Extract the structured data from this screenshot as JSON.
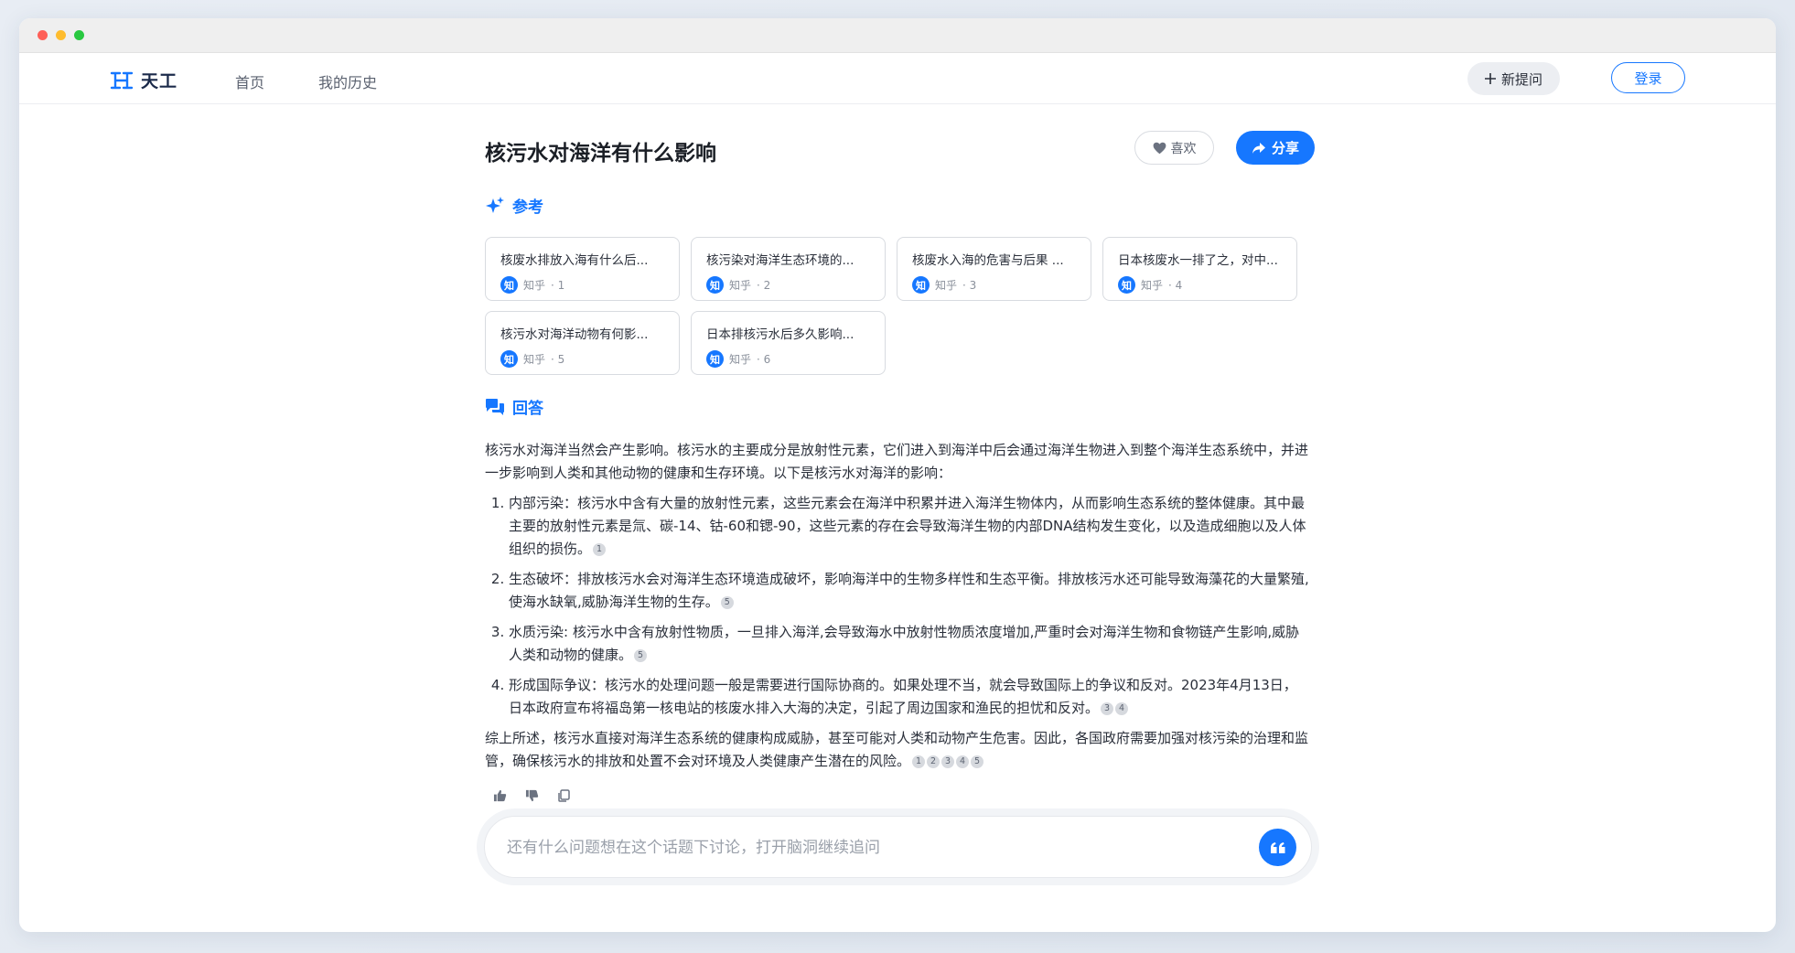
{
  "app": {
    "name": "天工"
  },
  "nav": {
    "home": "首页",
    "history": "我的历史",
    "new_question": "新提问",
    "login": "登录"
  },
  "question": {
    "title": "核污水对海洋有什么影响",
    "like_label": "喜欢",
    "share_label": "分享"
  },
  "references": {
    "heading": "参考",
    "items": [
      {
        "title": "核废水排放入海有什么后...",
        "source": "知乎",
        "badge": "知",
        "index": "· 1"
      },
      {
        "title": "核污染对海洋生态环境的...",
        "source": "知乎",
        "badge": "知",
        "index": "· 2"
      },
      {
        "title": "核废水入海的危害与后果 ...",
        "source": "知乎",
        "badge": "知",
        "index": "· 3"
      },
      {
        "title": "日本核废水一排了之，对中...",
        "source": "知乎",
        "badge": "知",
        "index": "· 4"
      },
      {
        "title": "核污水对海洋动物有何影...",
        "source": "知乎",
        "badge": "知",
        "index": "· 5"
      },
      {
        "title": "日本排核污水后多久影响...",
        "source": "知乎",
        "badge": "知",
        "index": "· 6"
      }
    ]
  },
  "answer": {
    "heading": "回答",
    "intro": "核污水对海洋当然会产生影响。核污水的主要成分是放射性元素，它们进入到海洋中后会通过海洋生物进入到整个海洋生态系统中，并进一步影响到人类和其他动物的健康和生存环境。以下是核污水对海洋的影响：",
    "points": [
      {
        "text": "内部污染：核污水中含有大量的放射性元素，这些元素会在海洋中积累并进入海洋生物体内，从而影响生态系统的整体健康。其中最主要的放射性元素是氚、碳-14、钴-60和锶-90，这些元素的存在会导致海洋生物的内部DNA结构发生变化，以及造成细胞以及人体组织的损伤。",
        "cites": [
          "1"
        ]
      },
      {
        "text": "生态破坏：排放核污水会对海洋生态环境造成破坏，影响海洋中的生物多样性和生态平衡。排放核污水还可能导致海藻花的大量繁殖,使海水缺氧,威胁海洋生物的生存。",
        "cites": [
          "5"
        ]
      },
      {
        "text": "水质污染: 核污水中含有放射性物质，一旦排入海洋,会导致海水中放射性物质浓度增加,严重时会对海洋生物和食物链产生影响,威胁人类和动物的健康。",
        "cites": [
          "5"
        ]
      },
      {
        "text": "形成国际争议：核污水的处理问题一般是需要进行国际协商的。如果处理不当，就会导致国际上的争议和反对。2023年4月13日，日本政府宣布将福岛第一核电站的核废水排入大海的决定，引起了周边国家和渔民的担忧和反对。",
        "cites": [
          "3",
          "4"
        ]
      }
    ],
    "conclusion": "综上所述，核污水直接对海洋生态系统的健康构成威胁，甚至可能对人类和动物产生危害。因此，各国政府需要加强对核污染的治理和监管，确保核污水的排放和处置不会对环境及人类健康产生潜在的风险。",
    "conclusion_cites": [
      "1",
      "2",
      "3",
      "4",
      "5"
    ]
  },
  "followup": {
    "placeholder": "还有什么问题想在这个话题下讨论，打开脑洞继续追问",
    "value": ""
  },
  "colors": {
    "accent": "#1677ff",
    "citation_bg": "#d6d9de"
  }
}
